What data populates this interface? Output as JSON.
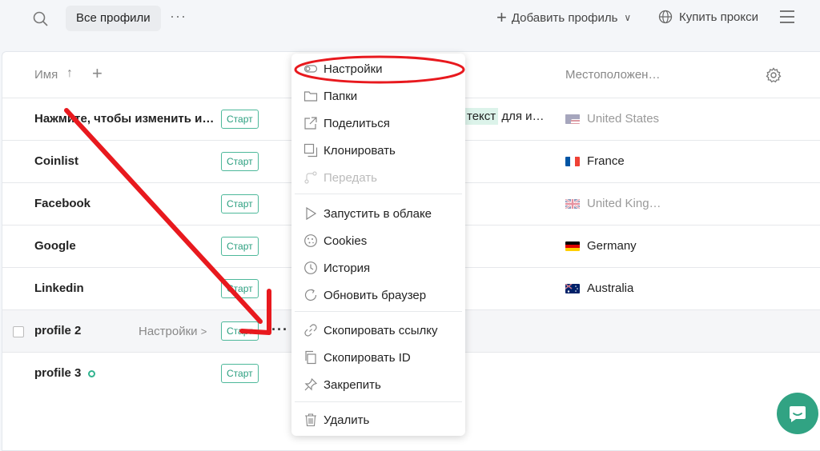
{
  "topbar": {
    "filter_label": "Все профили",
    "more_label": "···",
    "add_profile_label": "Добавить профиль",
    "buy_proxy_label": "Купить прокси"
  },
  "table": {
    "col_name": "Имя",
    "sort_symbol": "↑",
    "add_col_symbol": "+",
    "col_location": "Местоположен…",
    "rows": [
      {
        "name": "Нажмите, чтобы изменить и…",
        "start": "Старт",
        "tag": "текст",
        "tag_after": "для и…",
        "location": "United States",
        "dim": true
      },
      {
        "name": "Coinlist",
        "start": "Старт",
        "location": "France",
        "dim": false
      },
      {
        "name": "Facebook",
        "start": "Старт",
        "location": "United King…",
        "dim": true
      },
      {
        "name": "Google",
        "start": "Старт",
        "location": "Germany",
        "dim": false
      },
      {
        "name": "Linkedin",
        "start": "Старт",
        "location": "Australia",
        "dim": false
      },
      {
        "name": "profile 2",
        "start": "Старт",
        "settings": "Настройки",
        "more": "···"
      },
      {
        "name": "profile 3",
        "start": "Старт"
      }
    ]
  },
  "menu": {
    "items": [
      {
        "label": "Настройки",
        "icon": "toggle-icon"
      },
      {
        "label": "Папки",
        "icon": "folder-icon"
      },
      {
        "label": "Поделиться",
        "icon": "share-icon"
      },
      {
        "label": "Клонировать",
        "icon": "clone-icon"
      },
      {
        "label": "Передать",
        "icon": "transfer-icon",
        "disabled": true
      },
      {
        "label": "Запустить в облаке",
        "icon": "play-icon"
      },
      {
        "label": "Cookies",
        "icon": "cookie-icon"
      },
      {
        "label": "История",
        "icon": "history-icon"
      },
      {
        "label": "Обновить браузер",
        "icon": "refresh-icon"
      },
      {
        "label": "Скопировать ссылку",
        "icon": "link-icon"
      },
      {
        "label": "Скопировать ID",
        "icon": "copy-icon"
      },
      {
        "label": "Закрепить",
        "icon": "pin-icon"
      },
      {
        "label": "Удалить",
        "icon": "trash-icon"
      }
    ]
  },
  "colors": {
    "accent": "#31a383",
    "annotation_red": "#e8191e"
  }
}
